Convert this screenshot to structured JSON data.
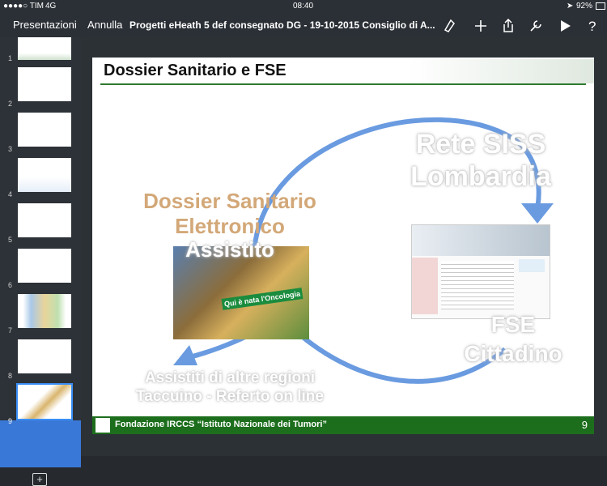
{
  "status": {
    "carrier": "●●●●○ TIM",
    "network": "4G",
    "time": "08:40",
    "battery": "92%"
  },
  "toolbar": {
    "back_label": "Presentazioni",
    "undo_label": "Annulla",
    "doc_title": "Progetti eHeath 5 def consegnato DG - 19-10-2015 Consiglio di A..."
  },
  "slides": [
    {
      "num": "1"
    },
    {
      "num": "2"
    },
    {
      "num": "3"
    },
    {
      "num": "4"
    },
    {
      "num": "5"
    },
    {
      "num": "6"
    },
    {
      "num": "7"
    },
    {
      "num": "8"
    },
    {
      "num": "9"
    }
  ],
  "slide": {
    "title": "Dossier Sanitario e FSE",
    "dossier_line1": "Dossier Sanitario",
    "dossier_line2": "Elettronico",
    "dossier_line3": "Assistito",
    "rete_line1": "Rete SISS",
    "rete_line2": "Lombardia",
    "fse_line1": "FSE",
    "fse_line2": "Cittadino",
    "assistiti_line1": "Assistiti di altre regioni",
    "assistiti_line2": "Taccuino - Referto on line",
    "footer": "Fondazione IRCCS “Istituto Nazionale dei Tumori”",
    "page_number": "9"
  },
  "colors": {
    "accent": "#3a78d8",
    "footer_green": "#1c6e1c",
    "orange_text": "#d3a878"
  }
}
